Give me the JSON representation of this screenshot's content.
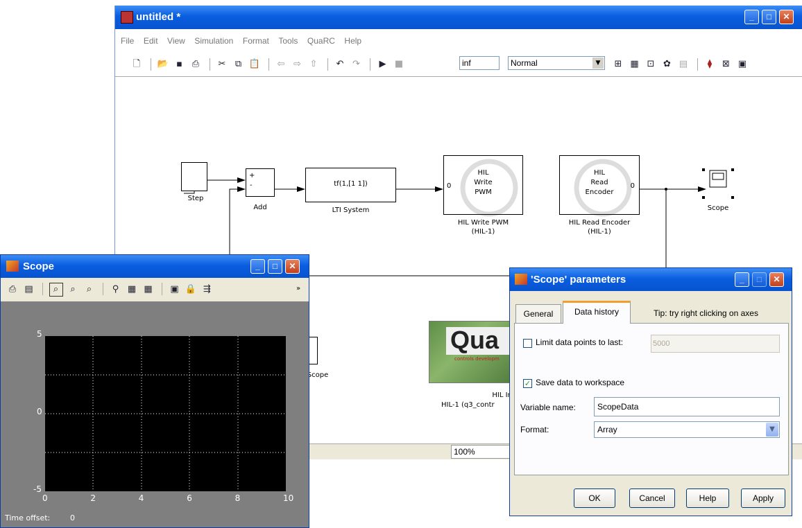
{
  "model_window": {
    "title": "untitled *",
    "menu": [
      "File",
      "Edit",
      "View",
      "Simulation",
      "Format",
      "Tools",
      "QuaRC",
      "Help"
    ],
    "stop_time": "inf",
    "sim_mode": "Normal",
    "zoom": "100%",
    "blocks": {
      "step": "Step",
      "add": "Add",
      "add_plus": "+",
      "add_minus": "-",
      "lti_expr": "tf(1,[1 1])",
      "lti": "LTI System",
      "write_inner": [
        "HIL",
        "Write",
        "PWM"
      ],
      "write_port": "0",
      "write_label": [
        "HIL Write PWM",
        "(HIL-1)"
      ],
      "read_inner": [
        "HIL",
        "Read",
        "Encoder"
      ],
      "read_port": "0",
      "read_label": [
        "HIL Read Encoder",
        "(HIL-1)"
      ],
      "scope": "Scope",
      "scope2": "Scope",
      "init_logo": "Qua",
      "init_tagline": "controls developm",
      "init_label": [
        "HIL Init",
        "HIL-1 (q3_contr"
      ]
    }
  },
  "scope_window": {
    "title": "Scope",
    "y_ticks": [
      "5",
      "0",
      "-5"
    ],
    "x_ticks": [
      "0",
      "2",
      "4",
      "6",
      "8",
      "10"
    ],
    "time_offset_label": "Time offset:",
    "time_offset_value": "0"
  },
  "params_dialog": {
    "title": "'Scope' parameters",
    "tabs": [
      "General",
      "Data history"
    ],
    "tip": "Tip: try right clicking on axes",
    "limit_label": "Limit data points to last:",
    "limit_value": "5000",
    "limit_checked": false,
    "save_label": "Save data to workspace",
    "save_checked": true,
    "varname_label": "Variable name:",
    "varname_value": "ScopeData",
    "format_label": "Format:",
    "format_value": "Array",
    "buttons": [
      "OK",
      "Cancel",
      "Help",
      "Apply"
    ]
  },
  "colors": {
    "titlebar": "#0a5ee0",
    "window_face": "#ece9d8",
    "scope_bg": "#7f7f7f",
    "plot_bg": "#000000"
  }
}
